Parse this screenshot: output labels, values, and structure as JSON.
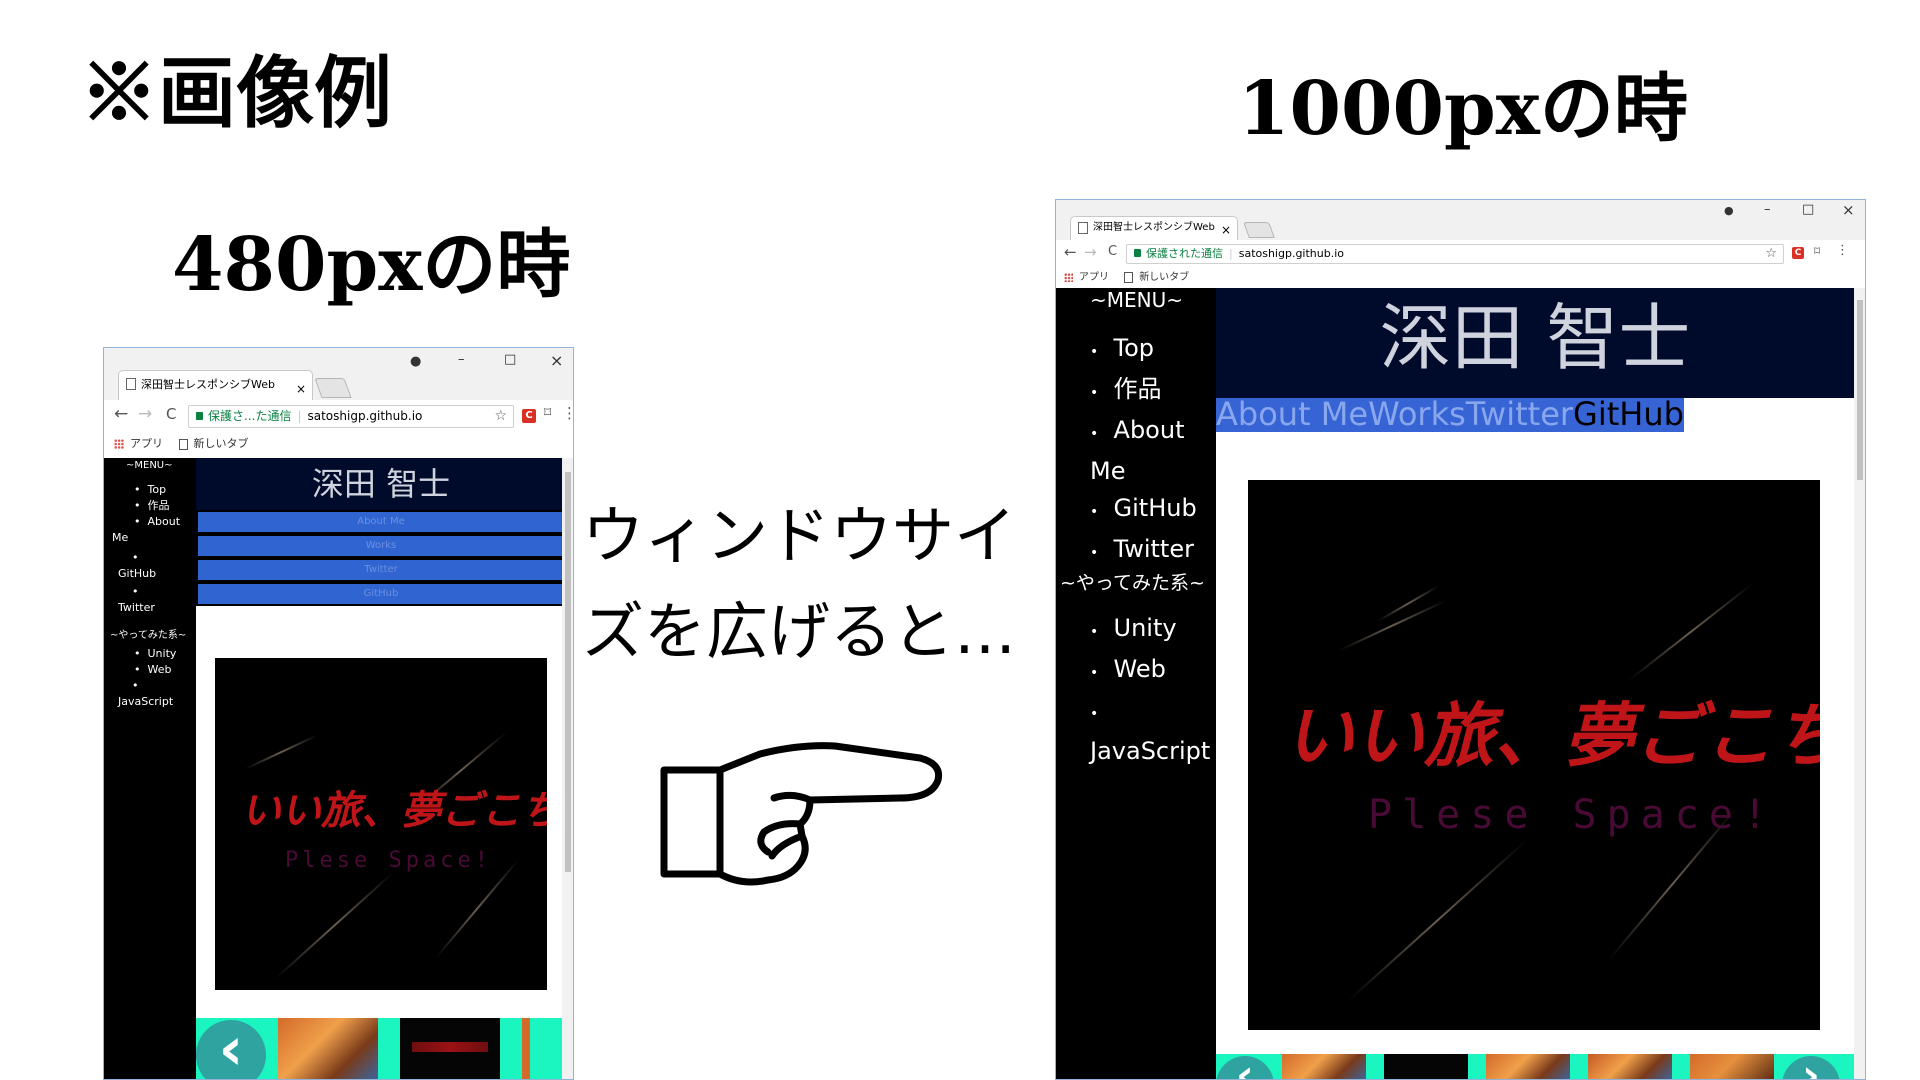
{
  "slide": {
    "title_example": "※画像例",
    "title_480": "480pxの時",
    "title_1000": "1000pxの時",
    "caption_line1": "ウィンドウサイ",
    "caption_line2": "ズを広げると…"
  },
  "browser": {
    "tab_title_small": "深田智士レスポンシブWeb",
    "tab_title_large": "深田智士レスポンシブWeb",
    "secure_label_small": "保護さ...た通信",
    "secure_label_large": "保護された通信",
    "url": "satoshigp.github.io",
    "bookmark_apps": "アプリ",
    "bookmark_newtab": "新しいタブ",
    "tab_close": "×",
    "win_account": "●",
    "win_min": "–",
    "win_max": "□",
    "win_close": "×",
    "nav_back": "←",
    "nav_forward": "→",
    "nav_reload": "C",
    "star": "☆",
    "ext_icon": "C",
    "cast": "⌑",
    "more": "⋮"
  },
  "site": {
    "name": "深田 智士",
    "menu_heading": "~MENU~",
    "menu_items": [
      "Top",
      "作品",
      "About Me",
      "GitHub",
      "Twitter"
    ],
    "tried_heading": "~やってみた系~",
    "tried_items": [
      "Unity",
      "Web",
      "JavaScript"
    ],
    "nav_buttons": [
      "About Me",
      "Works",
      "Twitter",
      "GitHub"
    ],
    "game_title": "いい旅、夢ごこち",
    "game_subtitle": "Plese Space!",
    "carousel_prev": "‹",
    "carousel_next": "›"
  },
  "icons": {
    "pointing_hand": "pointing-hand-icon",
    "lock": "lock-icon",
    "apps": "apps-grid-icon"
  },
  "colors": {
    "header_bg": "#000a2b",
    "nav_button": "#2f64d1",
    "carousel_bg": "#1bf5c0",
    "sidebar_bg": "#000000",
    "game_title": "#c01518"
  }
}
